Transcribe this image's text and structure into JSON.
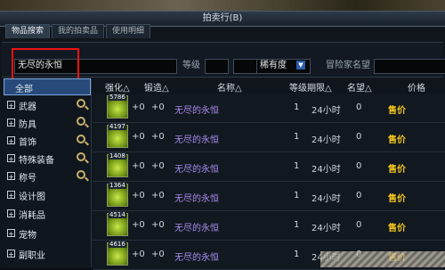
{
  "window": {
    "title": "拍卖行(B)"
  },
  "tabs": [
    {
      "label": "物品搜索"
    },
    {
      "label": "我的拍卖品"
    },
    {
      "label": "使用明细"
    }
  ],
  "search": {
    "item_name": "无尽的永恒",
    "level_label": "等级",
    "rarity_value": "稀有度",
    "adventurer_label": "冒险家名望"
  },
  "categories": [
    {
      "label": "全部"
    },
    {
      "label": "武器"
    },
    {
      "label": "防具"
    },
    {
      "label": "首饰"
    },
    {
      "label": "特殊装备"
    },
    {
      "label": "称号"
    },
    {
      "label": "设计图"
    },
    {
      "label": "消耗品"
    },
    {
      "label": "宠物"
    },
    {
      "label": "副职业"
    }
  ],
  "table": {
    "headers": [
      "强化△",
      "锻造△",
      "名称△",
      "等级期限△",
      "名望△",
      "价格"
    ],
    "rows": [
      {
        "code": "5786",
        "enh": "+0",
        "forge": "+0",
        "name": "无尽的永恒",
        "level": "1",
        "period": "24小时",
        "fame": "0",
        "price": "售价"
      },
      {
        "code": "4197",
        "enh": "+0",
        "forge": "+0",
        "name": "无尽的永恒",
        "level": "1",
        "period": "24小时",
        "fame": "0",
        "price": "售价"
      },
      {
        "code": "1408",
        "enh": "+0",
        "forge": "+0",
        "name": "无尽的永恒",
        "level": "1",
        "period": "24小时",
        "fame": "0",
        "price": "售价"
      },
      {
        "code": "1364",
        "enh": "+0",
        "forge": "+0",
        "name": "无尽的永恒",
        "level": "1",
        "period": "24小时",
        "fame": "0",
        "price": "售价"
      },
      {
        "code": "4514",
        "enh": "+0",
        "forge": "+0",
        "name": "无尽的永恒",
        "level": "1",
        "period": "24小时",
        "fame": "0",
        "price": "售价"
      },
      {
        "code": "4616",
        "enh": "+0",
        "forge": "+0",
        "name": "无尽的永恒",
        "level": "1",
        "period": "24小时",
        "fame": "0",
        "price": "售价"
      }
    ]
  },
  "colors": {
    "accent_blue": "#284a7a",
    "name_purple": "#a88bf0",
    "price_gold": "#f0c31d",
    "highlight_red": "#e11111"
  }
}
